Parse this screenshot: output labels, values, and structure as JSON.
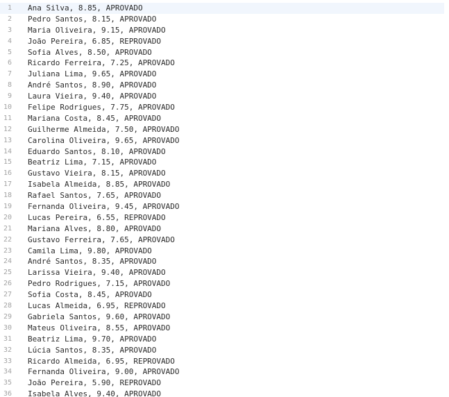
{
  "editor": {
    "current_line": 1,
    "lines": [
      {
        "n": "1",
        "text": "Ana Silva, 8.85, APROVADO"
      },
      {
        "n": "2",
        "text": "Pedro Santos, 8.15, APROVADO"
      },
      {
        "n": "3",
        "text": "Maria Oliveira, 9.15, APROVADO"
      },
      {
        "n": "4",
        "text": "João Pereira, 6.85, REPROVADO"
      },
      {
        "n": "5",
        "text": "Sofia Alves, 8.50, APROVADO"
      },
      {
        "n": "6",
        "text": "Ricardo Ferreira, 7.25, APROVADO"
      },
      {
        "n": "7",
        "text": "Juliana Lima, 9.65, APROVADO"
      },
      {
        "n": "8",
        "text": "André Santos, 8.90, APROVADO"
      },
      {
        "n": "9",
        "text": "Laura Vieira, 9.40, APROVADO"
      },
      {
        "n": "10",
        "text": "Felipe Rodrigues, 7.75, APROVADO"
      },
      {
        "n": "11",
        "text": "Mariana Costa, 8.45, APROVADO"
      },
      {
        "n": "12",
        "text": "Guilherme Almeida, 7.50, APROVADO"
      },
      {
        "n": "13",
        "text": "Carolina Oliveira, 9.65, APROVADO"
      },
      {
        "n": "14",
        "text": "Eduardo Santos, 8.10, APROVADO"
      },
      {
        "n": "15",
        "text": "Beatriz Lima, 7.15, APROVADO"
      },
      {
        "n": "16",
        "text": "Gustavo Vieira, 8.15, APROVADO"
      },
      {
        "n": "17",
        "text": "Isabela Almeida, 8.85, APROVADO"
      },
      {
        "n": "18",
        "text": "Rafael Santos, 7.65, APROVADO"
      },
      {
        "n": "19",
        "text": "Fernanda Oliveira, 9.45, APROVADO"
      },
      {
        "n": "20",
        "text": "Lucas Pereira, 6.55, REPROVADO"
      },
      {
        "n": "21",
        "text": "Mariana Alves, 8.80, APROVADO"
      },
      {
        "n": "22",
        "text": "Gustavo Ferreira, 7.65, APROVADO"
      },
      {
        "n": "23",
        "text": "Camila Lima, 9.80, APROVADO"
      },
      {
        "n": "24",
        "text": "André Santos, 8.35, APROVADO"
      },
      {
        "n": "25",
        "text": "Larissa Vieira, 9.40, APROVADO"
      },
      {
        "n": "26",
        "text": "Pedro Rodrigues, 7.15, APROVADO"
      },
      {
        "n": "27",
        "text": "Sofia Costa, 8.45, APROVADO"
      },
      {
        "n": "28",
        "text": "Lucas Almeida, 6.95, REPROVADO"
      },
      {
        "n": "29",
        "text": "Gabriela Santos, 9.60, APROVADO"
      },
      {
        "n": "30",
        "text": "Mateus Oliveira, 8.55, APROVADO"
      },
      {
        "n": "31",
        "text": "Beatriz Lima, 9.70, APROVADO"
      },
      {
        "n": "32",
        "text": "Lúcia Santos, 8.35, APROVADO"
      },
      {
        "n": "33",
        "text": "Ricardo Almeida, 6.95, REPROVADO"
      },
      {
        "n": "34",
        "text": "Fernanda Oliveira, 9.00, APROVADO"
      },
      {
        "n": "35",
        "text": "João Pereira, 5.90, REPROVADO"
      },
      {
        "n": "36",
        "text": "Isabela Alves, 9.40, APROVADO"
      }
    ]
  }
}
